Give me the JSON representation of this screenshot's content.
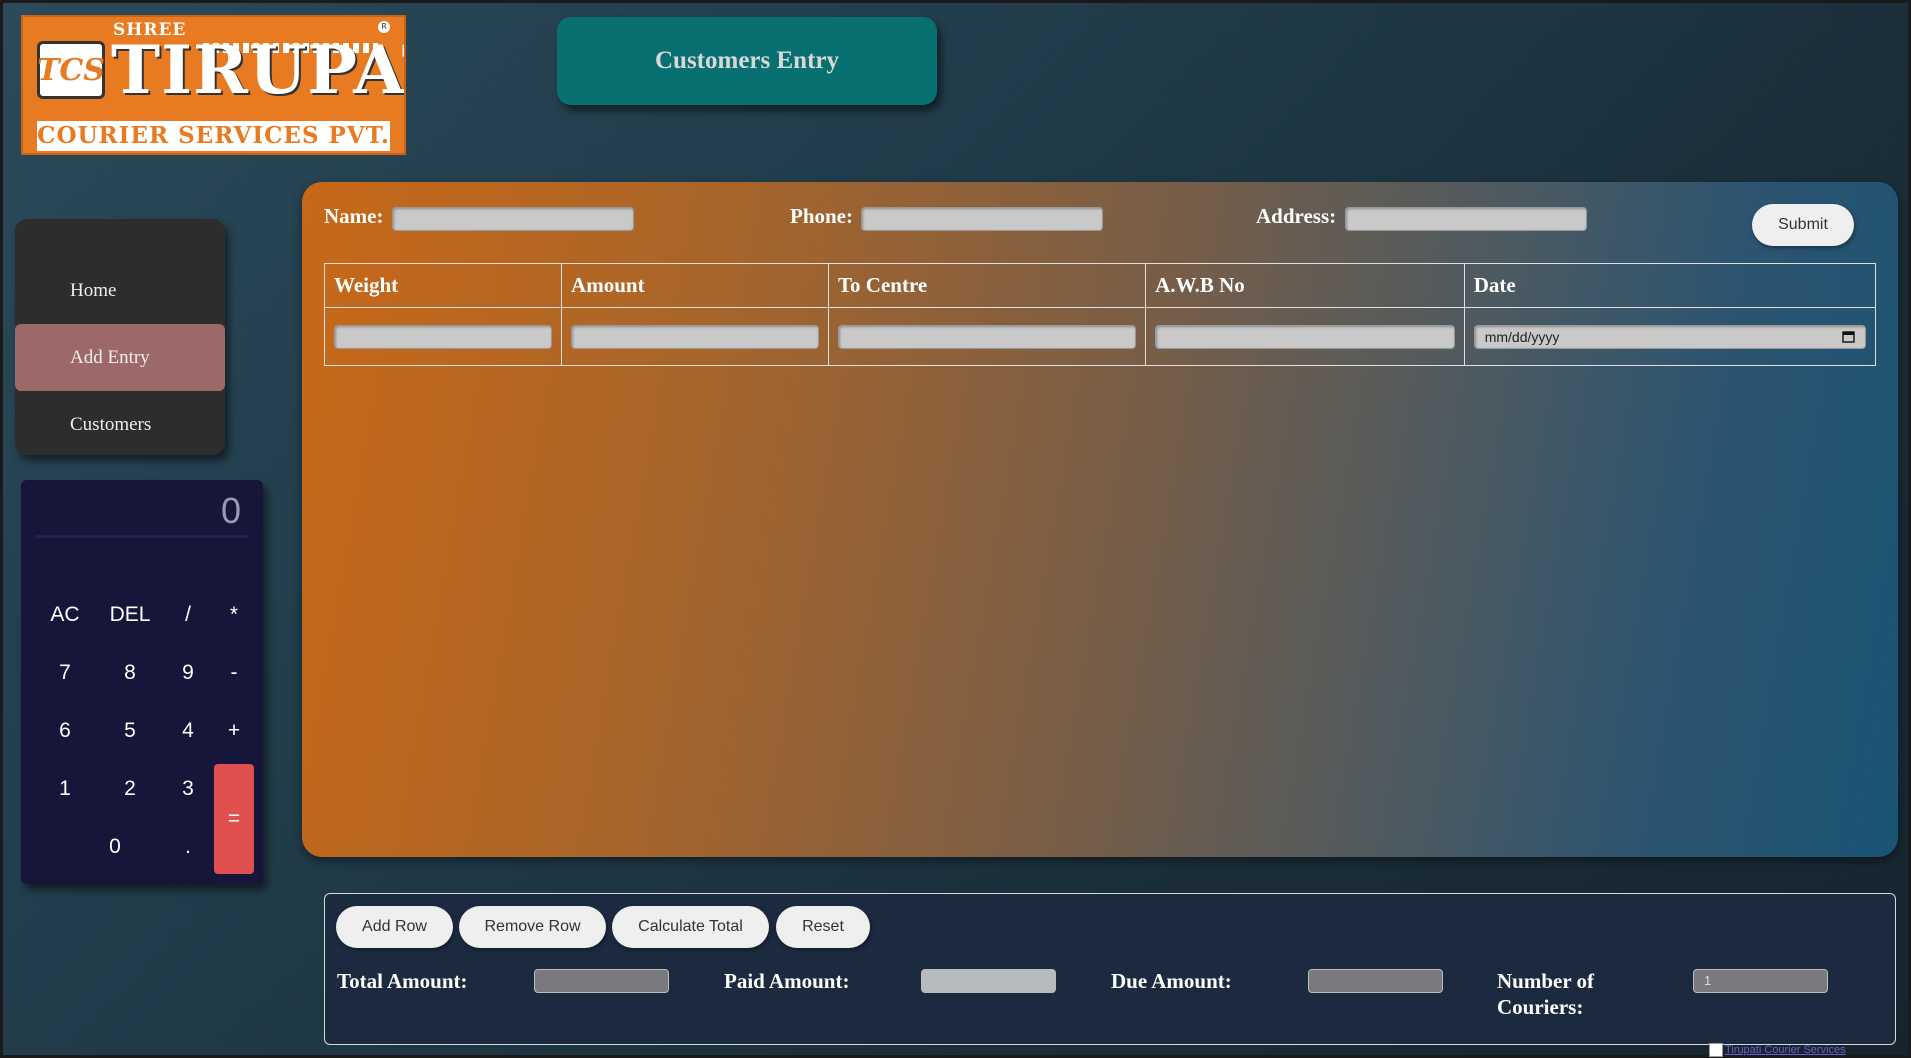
{
  "logo": {
    "shree": "SHREE",
    "mark": "TCS",
    "brand": "TIRUPATI",
    "reg": "R",
    "sub": "COURIER SERVICES PVT. LTD."
  },
  "header": {
    "title": "Customers Entry"
  },
  "nav": {
    "items": [
      {
        "label": "Home",
        "active": false
      },
      {
        "label": "Add Entry",
        "active": true
      },
      {
        "label": "Customers",
        "active": false
      }
    ]
  },
  "calculator": {
    "display": "0",
    "keys": {
      "ac": "AC",
      "del": "DEL",
      "div": "/",
      "mul": "*",
      "k7": "7",
      "k8": "8",
      "k9": "9",
      "sub": "-",
      "k6": "6",
      "k5": "5",
      "k4": "4",
      "add": "+",
      "k1": "1",
      "k2": "2",
      "k3": "3",
      "eq": "=",
      "k0": "0",
      "dot": "."
    }
  },
  "customer_form": {
    "name_label": "Name:",
    "name_value": "",
    "phone_label": "Phone:",
    "phone_value": "",
    "address_label": "Address:",
    "address_value": "",
    "submit_label": "Submit"
  },
  "entries_table": {
    "columns": [
      "Weight",
      "Amount",
      "To Centre",
      "A.W.B No",
      "Date"
    ],
    "rows": [
      {
        "weight": "",
        "amount": "",
        "to_centre": "",
        "awb_no": "",
        "date_placeholder": "mm/dd/yyyy"
      }
    ]
  },
  "actions": {
    "add_row": "Add Row",
    "remove_row": "Remove Row",
    "calculate_total": "Calculate Total",
    "reset": "Reset"
  },
  "summary": {
    "total_label": "Total Amount:",
    "total_value": "",
    "paid_label": "Paid Amount:",
    "paid_value": "",
    "due_label": "Due Amount:",
    "due_value": "",
    "couriers_label_1": "Number of",
    "couriers_label_2": "Couriers:",
    "couriers_value": "1"
  },
  "footer_image_alt": "Tirupati Courier Services"
}
